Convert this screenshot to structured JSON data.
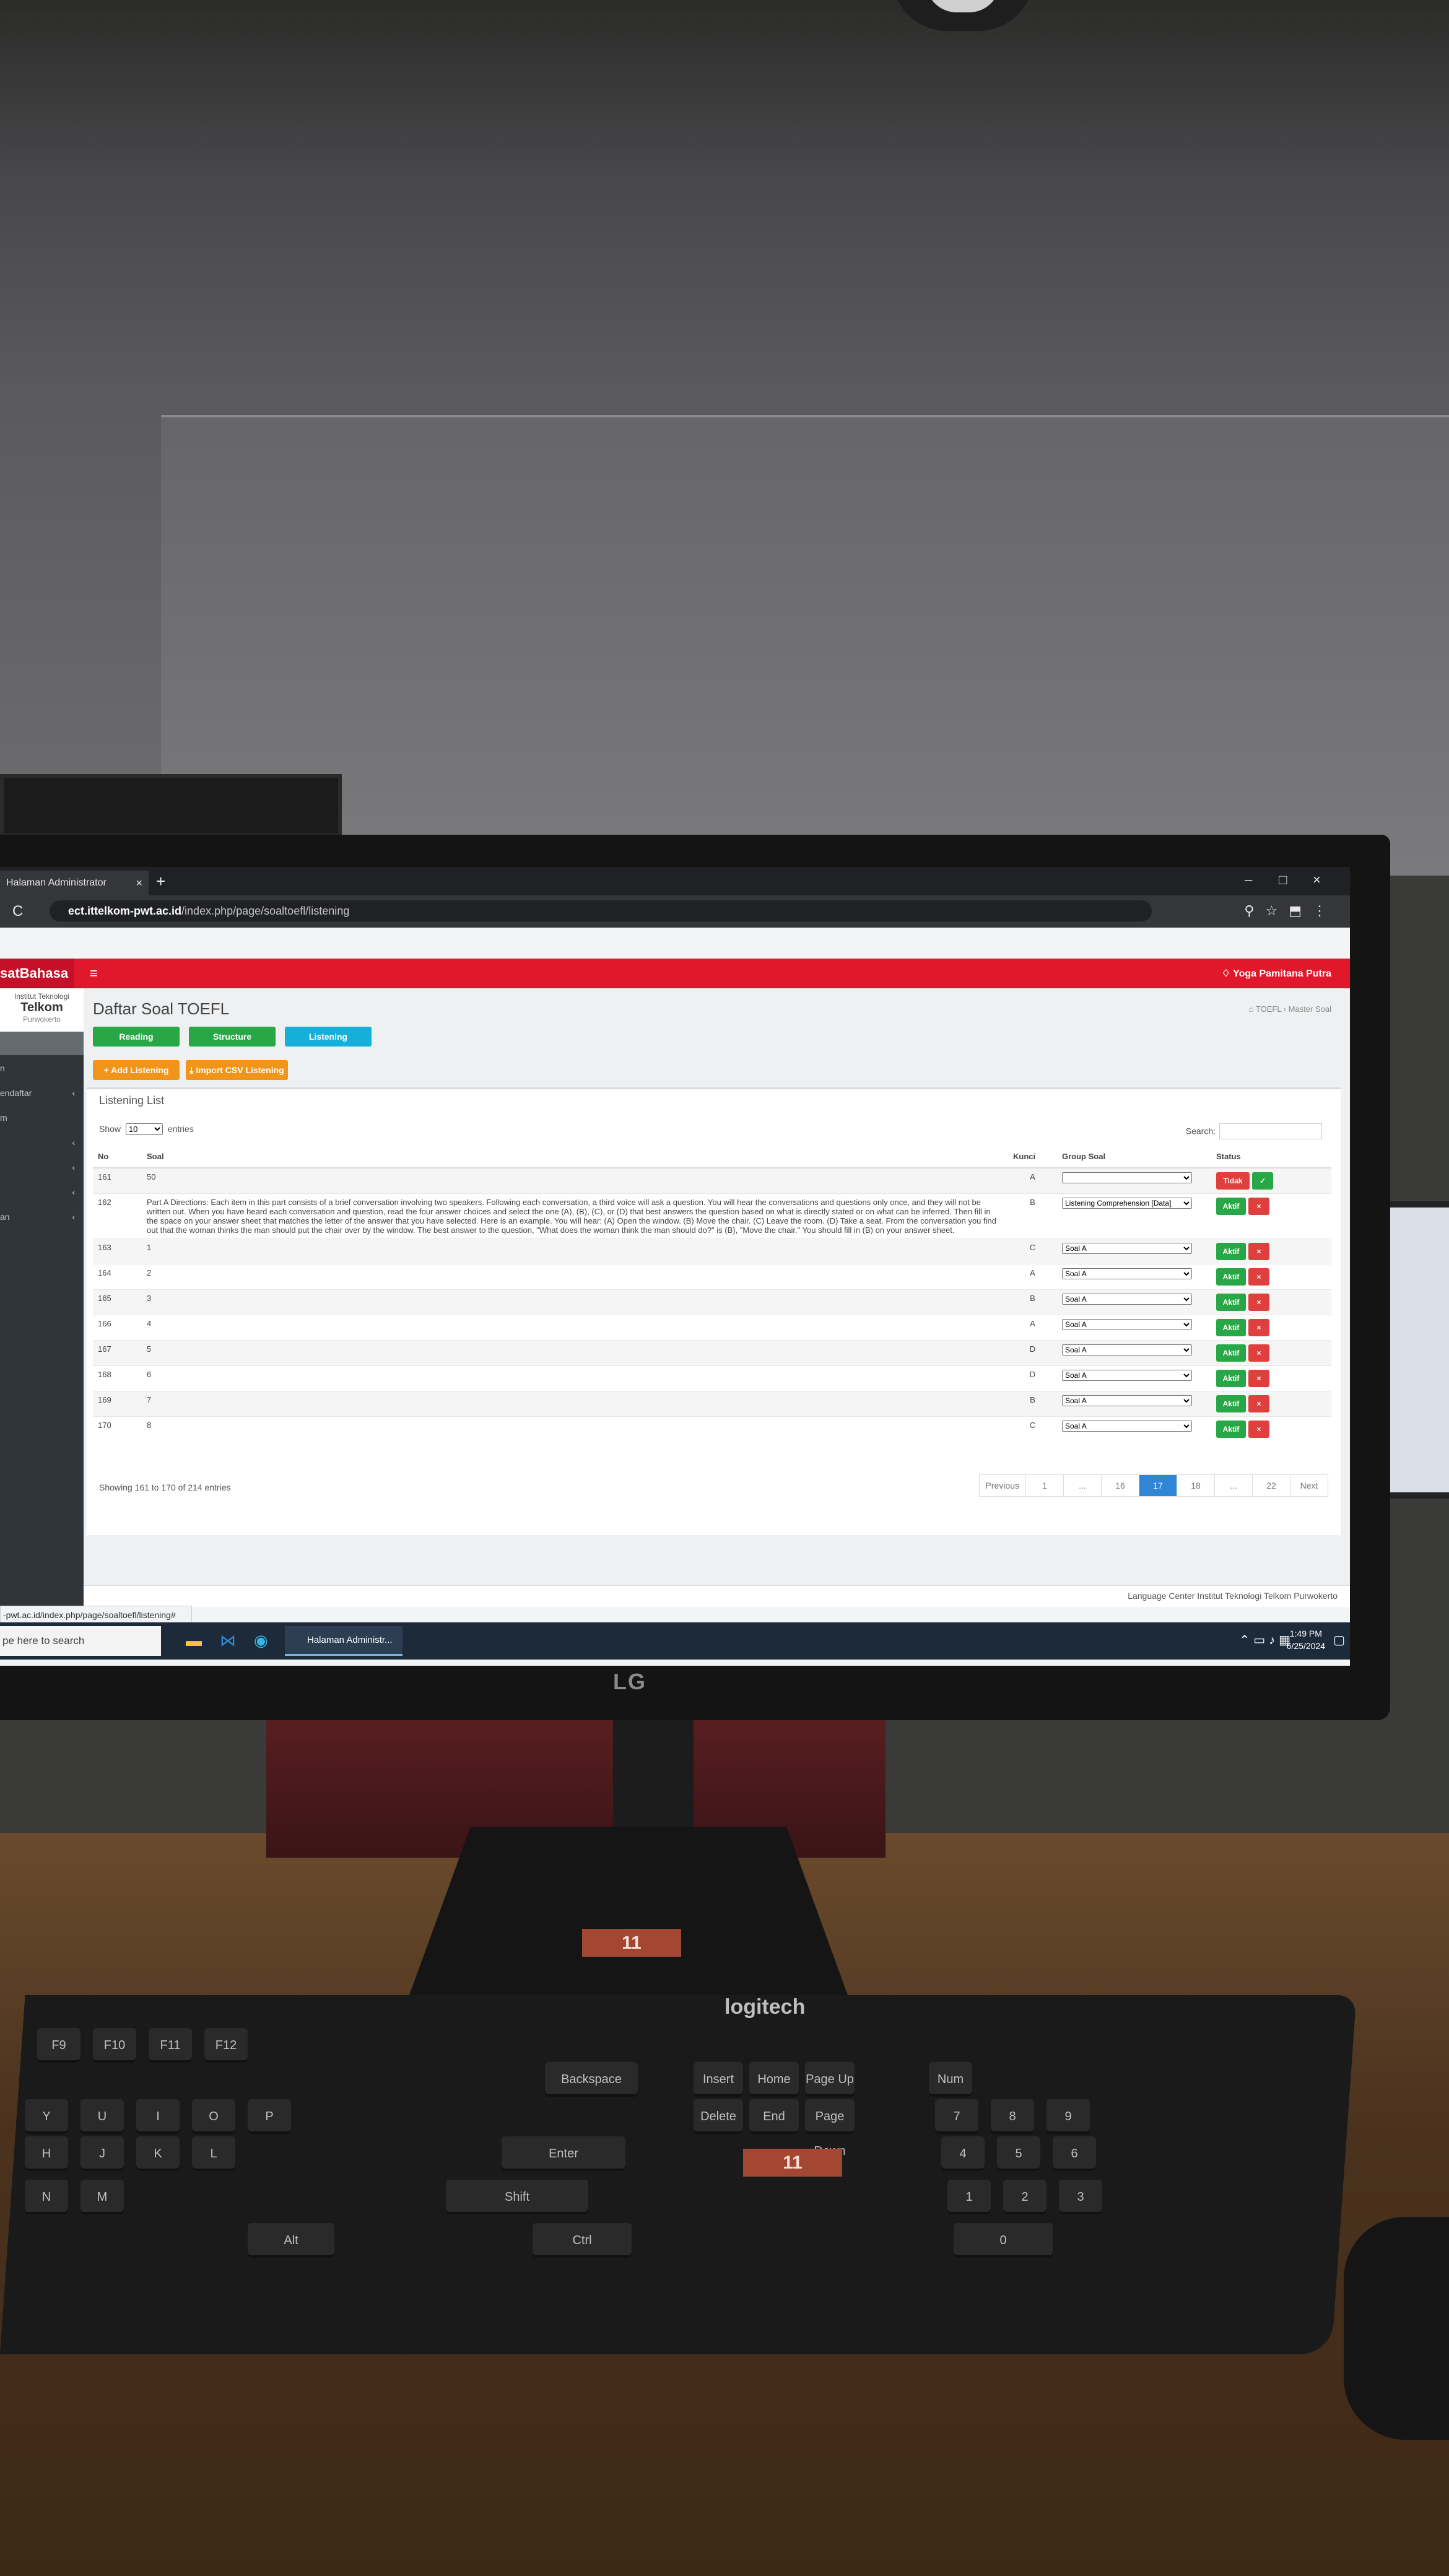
{
  "browser": {
    "tab_title": "Halaman Administrator",
    "tab_close": "×",
    "new_tab": "+",
    "window_controls": [
      "–",
      "□",
      "×"
    ],
    "reload": "C",
    "url_host": "ect.ittelkom-pwt.ac.id",
    "url_path": "/index.php/page/soaltoefl/listening",
    "status_url": "-pwt.ac.id/index.php/page/soaltoefl/listening#"
  },
  "app": {
    "brand": "satBahasa",
    "user_name": "Yoga Pamitana Putra",
    "logo_line1": "Institut Teknologi",
    "logo_line2": "Telkom",
    "logo_line3": "Purwokerto"
  },
  "sidebar": {
    "items": [
      {
        "label": "",
        "active": true
      },
      {
        "label": "n",
        "active": false
      },
      {
        "label": "endaftar",
        "active": false,
        "caret": "‹"
      },
      {
        "label": "m",
        "active": false
      },
      {
        "label": "",
        "active": false,
        "caret": "‹"
      },
      {
        "label": "",
        "active": false,
        "caret": "‹"
      },
      {
        "label": "",
        "active": false,
        "caret": "‹"
      },
      {
        "label": "an",
        "active": false,
        "caret": "‹"
      }
    ]
  },
  "page": {
    "title": "Daftar Soal TOEFL",
    "breadcrumb": "⌂ TOEFL  ›  Master Soal",
    "tabs": {
      "reading": "Reading",
      "structure": "Structure",
      "listening": "Listening"
    },
    "actions": {
      "add": "+ Add Listening",
      "import": "⤓ Import CSV Listening"
    },
    "box_title": "Listening List",
    "show_label": "Show",
    "show_value": "10",
    "entries_label": "entries",
    "search_label": "Search:",
    "columns": [
      "No",
      "Soal",
      "Kunci",
      "Group Soal",
      "Status"
    ],
    "showing": "Showing 161 to 170 of 214 entries",
    "pagination": [
      "Previous",
      "1",
      "...",
      "16",
      "17",
      "18",
      "...",
      "22",
      "Next"
    ],
    "pagination_active": "17"
  },
  "rows": [
    {
      "no": "161",
      "soal": "50",
      "kunci": "A",
      "group": "",
      "status": [
        "Tidak",
        "✓"
      ]
    },
    {
      "no": "162",
      "soal": "Part A Directions: Each item in this part consists of a brief conversation involving two speakers. Following each conversation, a third voice will ask a question. You will hear the conversations and questions only once, and they will not be written out. When you have heard each conversation and question, read the four answer choices and select the one (A), (B), (C), or (D) that best answers the question based on what is directly stated or on what can be inferred. Then fill in the space on your answer sheet that matches the letter of the answer that you have selected. Here is an example. You will hear: (A) Open the window. (B) Move the chair. (C) Leave the room. (D) Take a seat. From the conversation you find out that the woman thinks the man should put the chair over by the window. The best answer to the question, \"What does the woman think the man should do?\" is (B), \"Move the chair.\" You should fill in (B) on your answer sheet.",
      "kunci": "B",
      "group": "Listening Comprehension [Data]",
      "status": [
        "Aktif",
        "×"
      ]
    },
    {
      "no": "163",
      "soal": "1",
      "kunci": "C",
      "group": "Soal A",
      "status": [
        "Aktif",
        "×"
      ]
    },
    {
      "no": "164",
      "soal": "2",
      "kunci": "A",
      "group": "Soal A",
      "status": [
        "Aktif",
        "×"
      ]
    },
    {
      "no": "165",
      "soal": "3",
      "kunci": "B",
      "group": "Soal A",
      "status": [
        "Aktif",
        "×"
      ]
    },
    {
      "no": "166",
      "soal": "4",
      "kunci": "A",
      "group": "Soal A",
      "status": [
        "Aktif",
        "×"
      ]
    },
    {
      "no": "167",
      "soal": "5",
      "kunci": "D",
      "group": "Soal A",
      "status": [
        "Aktif",
        "×"
      ]
    },
    {
      "no": "168",
      "soal": "6",
      "kunci": "D",
      "group": "Soal A",
      "status": [
        "Aktif",
        "×"
      ]
    },
    {
      "no": "169",
      "soal": "7",
      "kunci": "B",
      "group": "Soal A",
      "status": [
        "Aktif",
        "×"
      ]
    },
    {
      "no": "170",
      "soal": "8",
      "kunci": "C",
      "group": "Soal A",
      "status": [
        "Aktif",
        "×"
      ]
    }
  ],
  "footer": "Language Center Institut Teknologi Telkom Purwokerto",
  "taskbar": {
    "search": "pe here to search",
    "app_label": "Halaman Administr...",
    "time": "1:49 PM",
    "date": "6/25/2024"
  },
  "hardware": {
    "monitor_logo": "LG",
    "keyboard_logo": "logitech",
    "sticker": "11",
    "keyboard_sticker": "11"
  },
  "keys": [
    "Backspace",
    "Insert",
    "Home",
    "Page Up",
    "Delete",
    "End",
    "Page Down",
    "Enter",
    "Shift",
    "Ctrl",
    "Alt",
    "F9",
    "F10",
    "F11",
    "F12",
    "Num Lock",
    "Y",
    "U",
    "I",
    "O",
    "P",
    "H",
    "J",
    "K",
    "L",
    "N",
    "M",
    "7",
    "8",
    "9",
    "4",
    "5",
    "6",
    "1",
    "2",
    "3",
    "0"
  ],
  "colors": {
    "header_red": "#e1182b",
    "green": "#27a745",
    "blue": "#13b0d9",
    "orange": "#f0951a",
    "red": "#e0403d",
    "page_active": "#2f86d6"
  }
}
